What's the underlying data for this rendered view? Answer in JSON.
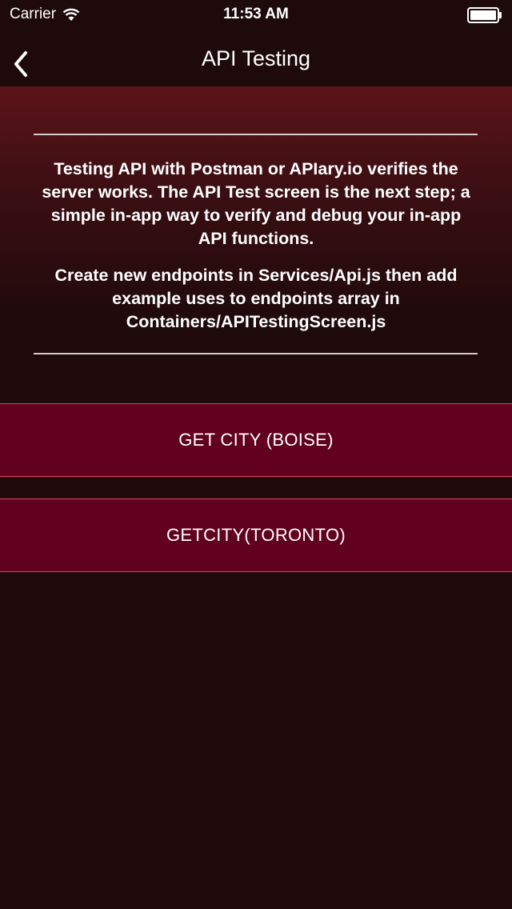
{
  "status_bar": {
    "carrier": "Carrier",
    "time": "11:53 AM"
  },
  "nav": {
    "title": "API Testing",
    "back_icon": "chevron-left-icon"
  },
  "intro": {
    "paragraph1": "Testing API with Postman or APIary.io verifies the server works. The API Test screen is the next step; a simple in-app way to verify and debug your in-app API functions.",
    "paragraph2": "Create new endpoints in Services/Api.js then add example uses to endpoints array in Containers/APITestingScreen.js"
  },
  "buttons": [
    {
      "label": "GET CITY (BOISE)"
    },
    {
      "label": "GETCITY(TORONTO)"
    }
  ],
  "colors": {
    "background": "#1e0a0b",
    "header_gradient_top": "#5b1419",
    "button_fill": "#61001f",
    "button_border": "#e0475a"
  }
}
